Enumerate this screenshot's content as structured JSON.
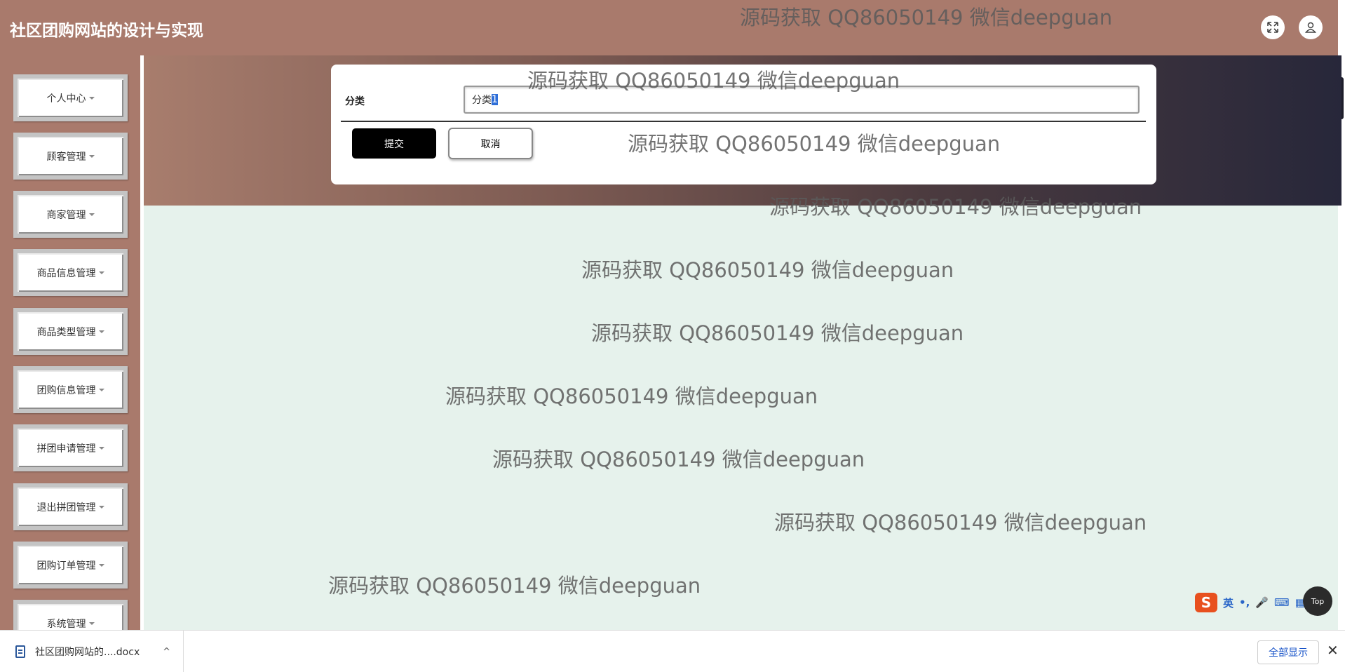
{
  "header": {
    "title": "社区团购网站的设计与实现",
    "icons": [
      "fullscreen-icon",
      "user-icon"
    ]
  },
  "sidebar": {
    "items": [
      {
        "label": "个人中心"
      },
      {
        "label": "顾客管理"
      },
      {
        "label": "商家管理"
      },
      {
        "label": "商品信息管理"
      },
      {
        "label": "商品类型管理"
      },
      {
        "label": "团购信息管理"
      },
      {
        "label": "拼团申请管理"
      },
      {
        "label": "退出拼团管理"
      },
      {
        "label": "团购订单管理"
      },
      {
        "label": "系统管理"
      }
    ]
  },
  "form": {
    "field_label": "分类",
    "field_value_prefix": "分类",
    "field_value_selected": "1",
    "submit_label": "提交",
    "cancel_label": "取消"
  },
  "watermark": {
    "text": "源码获取 QQ86050149 微信deepguan",
    "count": 10
  },
  "ime": {
    "logo": "S",
    "lang": "英",
    "punct": "•,",
    "mic": "🎤",
    "kbd": "⌨",
    "grid": "▦"
  },
  "back_to_top": {
    "label": "Top"
  },
  "downloads": {
    "file_name": "社区团购网站的....docx",
    "show_all_label": "全部显示",
    "close_glyph": "✕",
    "chevron_glyph": "^"
  },
  "colors": {
    "header_bg": "#a97a6c",
    "content_bg": "#e6f2ec",
    "submit_bg": "#000000",
    "link_blue": "#1a55c9"
  }
}
